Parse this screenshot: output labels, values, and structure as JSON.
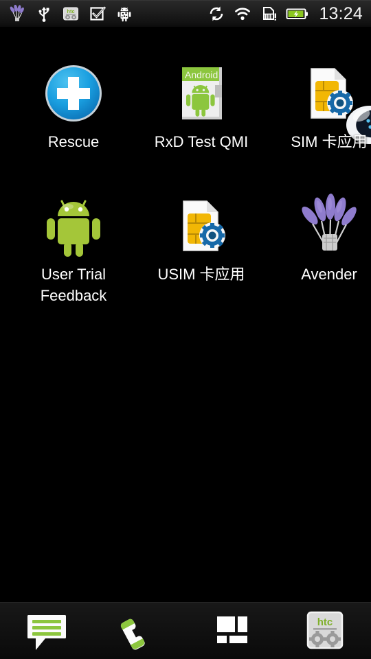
{
  "device": {
    "platform": "Android",
    "skin": "HTC Sense",
    "screen": "home-screen",
    "wallpaper_color": "#000000"
  },
  "status_bar": {
    "background_color": "#1d1d1d",
    "time": "13:24",
    "left_icons": [
      {
        "name": "lavender-flower-icon",
        "label": "Avender notification",
        "color": "#8f7ccd"
      },
      {
        "name": "usb-icon",
        "label": "USB connected",
        "color": "#ffffff"
      },
      {
        "name": "htc-settings-icon",
        "label": "HTC system tool",
        "color": "#d8d8d8"
      },
      {
        "name": "checkbox-icon",
        "label": "Task complete",
        "color": "#ffffff"
      },
      {
        "name": "android-debug-icon",
        "label": "USB debugging connected",
        "color": "#ffffff"
      }
    ],
    "right_icons": [
      {
        "name": "sync-icon",
        "label": "Syncing",
        "color": "#ffffff"
      },
      {
        "name": "wifi-icon",
        "label": "Wi-Fi connected",
        "color": "#ffffff"
      },
      {
        "name": "sim-alert-icon",
        "label": "No SIM card",
        "color": "#ffffff"
      },
      {
        "name": "battery-charging-icon",
        "label": "Battery charging",
        "color": "#8bc720"
      }
    ]
  },
  "home": {
    "rows": [
      {
        "apps": [
          {
            "label": "Rescue",
            "icon": "rescue-cross-icon",
            "colors": {
              "circle": "#1a9fe0",
              "cross": "#ffffff"
            }
          },
          {
            "label": "RxD Test QMI",
            "icon": "android-package-icon",
            "colors": {
              "header": "#8cc63e",
              "body": "#efefef"
            }
          },
          {
            "label": "SIM 卡应用",
            "icon": "sim-card-gear-icon",
            "colors": {
              "card": "#f2b705",
              "gear": "#1769a8"
            }
          }
        ]
      },
      {
        "apps": [
          {
            "label": "User Trial\nFeedback",
            "icon": "android-robot-icon",
            "colors": {
              "body": "#a4c639"
            }
          },
          {
            "label": "USIM 卡应用",
            "icon": "usim-card-gear-icon",
            "colors": {
              "card": "#f2b705",
              "gear": "#1769a8"
            }
          },
          {
            "label": "Avender",
            "icon": "lavender-bouquet-icon",
            "colors": {
              "flower": "#8f7ccd",
              "stem": "#cfcfcf"
            }
          }
        ]
      }
    ],
    "peek_icon": {
      "name": "next-page-peek-icon",
      "label": "partially visible app on next page"
    }
  },
  "dock": {
    "items": [
      {
        "label": "Messages",
        "icon": "message-bubble-icon",
        "accent": "#8cc63e"
      },
      {
        "label": "Phone",
        "icon": "phone-handset-icon",
        "accent": "#8cc63e"
      },
      {
        "label": "All apps",
        "icon": "app-drawer-icon",
        "accent": "#ffffff"
      },
      {
        "label": "HTC Settings",
        "icon": "htc-gears-icon",
        "accent": "#8cc63e"
      }
    ]
  }
}
